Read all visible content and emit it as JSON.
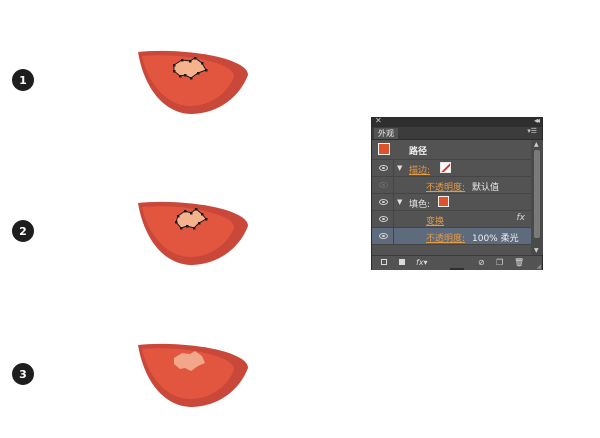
{
  "steps": [
    {
      "number": "1"
    },
    {
      "number": "2"
    },
    {
      "number": "3"
    }
  ],
  "colors": {
    "slice_outer": "#c9483a",
    "slice_inner": "#e2553f",
    "seed": "#f5b38d",
    "panel_bg": "#535353",
    "selected_row": "#5d6b7d",
    "accent_orange": "#e49a45"
  },
  "panel": {
    "tab": "外观",
    "title_row": {
      "label": "路径"
    },
    "rows": [
      {
        "label": "描边:",
        "icon": "stroke-none-swatch"
      },
      {
        "label": "不透明度:",
        "value": "默认值"
      },
      {
        "label": "填色:",
        "icon": "fill-swatch"
      },
      {
        "label": "变换",
        "icon": "fx-icon"
      },
      {
        "label": "不透明度:",
        "value": "100% 柔光"
      }
    ],
    "fx_text": "fx",
    "bottom_icons": [
      "new-stroke-icon",
      "new-fill-icon",
      "add-effect-icon",
      "clear-icon",
      "duplicate-icon",
      "delete-icon"
    ]
  }
}
